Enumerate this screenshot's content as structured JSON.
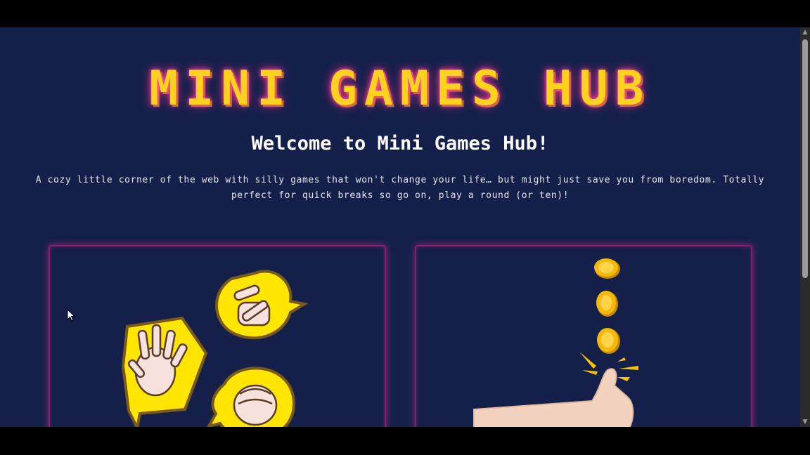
{
  "hero": {
    "title": "MINI GAMES HUB",
    "welcome": "Welcome to Mini Games Hub!",
    "intro_line1": "A cozy little corner of the web with silly games that won't change your life… but might just save you from boredom. Totally",
    "intro_line2": "perfect for quick breaks so go on, play a round (or ten)!"
  },
  "cards": [
    {
      "icon": "rock-paper-scissors-icon"
    },
    {
      "icon": "coin-flip-icon"
    }
  ],
  "colors": {
    "background": "#14204a",
    "title": "#ffd21f",
    "glow": "#ff2f8a",
    "card_border": "#8a1d6a"
  }
}
